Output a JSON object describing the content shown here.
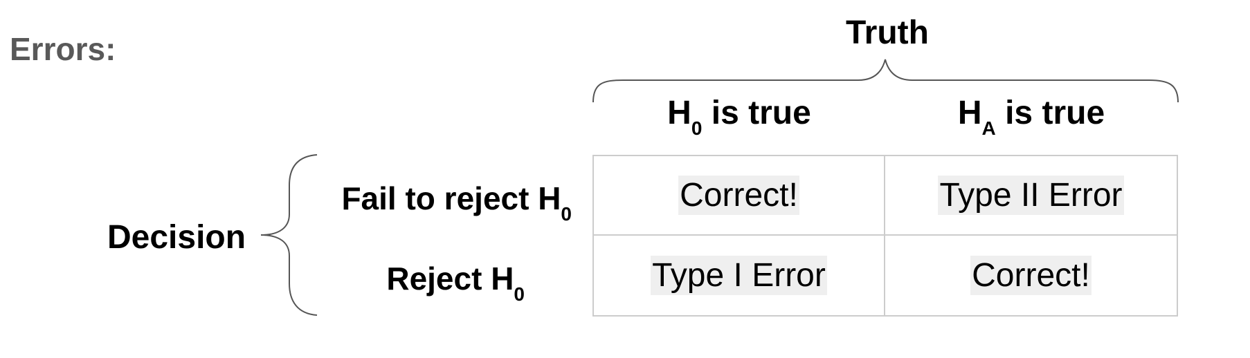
{
  "title": "Errors:",
  "truth_label": "Truth",
  "decision_label": "Decision",
  "columns": [
    {
      "main": "H",
      "sub": "0",
      "rest": " is true"
    },
    {
      "main": "H",
      "sub": "A",
      "rest": " is true"
    }
  ],
  "rows": [
    {
      "main": "Fail to reject H",
      "sub": "0"
    },
    {
      "main": "Reject H",
      "sub": "0"
    }
  ],
  "cells": [
    [
      "Correct!",
      "Type II Error"
    ],
    [
      "Type I Error",
      "Correct!"
    ]
  ],
  "colors": {
    "title": "#595959",
    "grid_border": "#cccccc",
    "cell_highlight": "#efefef",
    "brace": "#555555"
  }
}
